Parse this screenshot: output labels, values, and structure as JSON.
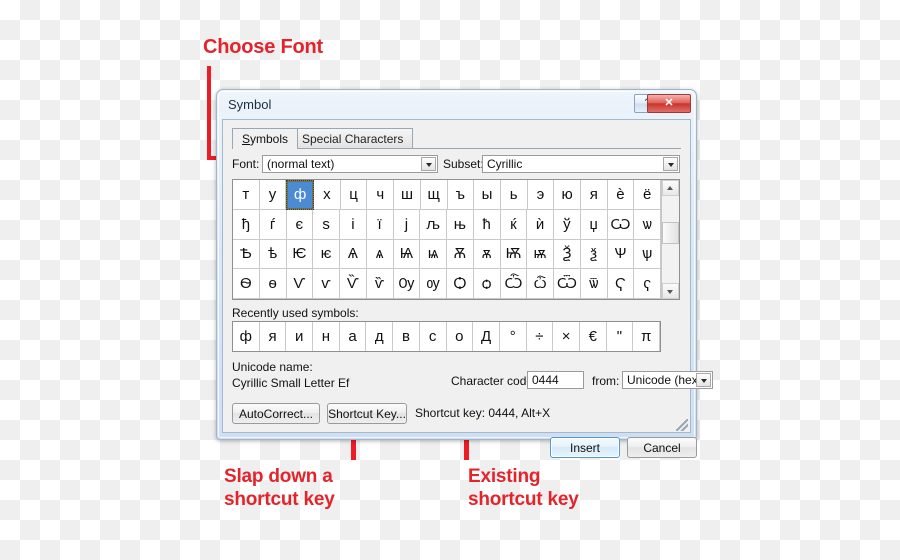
{
  "annotations": [
    {
      "id": "choose-font",
      "text": "Choose Font"
    },
    {
      "id": "slap-shortcut",
      "text": "Slap down a\nshortcut key"
    },
    {
      "id": "existing-shortcut",
      "text": "Existing\nshortcut key"
    }
  ],
  "accent_color": "#ec1c24",
  "dialog": {
    "title": "Symbol",
    "titlebar_buttons": {
      "help": "?",
      "close": "✕"
    },
    "tabs": [
      {
        "label": "Symbols",
        "active": true
      },
      {
        "label": "Special Characters",
        "active": false
      }
    ],
    "font": {
      "label": "Font:",
      "value": "(normal text)"
    },
    "subset": {
      "label": "Subset:",
      "value": "Cyrillic"
    },
    "grid": {
      "selected": "ф",
      "rows": [
        [
          "т",
          "у",
          "ф",
          "х",
          "ц",
          "ч",
          "ш",
          "щ",
          "ъ",
          "ы",
          "ь",
          "э",
          "ю",
          "я",
          "ѐ",
          "ё"
        ],
        [
          "ђ",
          "ѓ",
          "є",
          "ѕ",
          "і",
          "ї",
          "ј",
          "љ",
          "њ",
          "ћ",
          "ќ",
          "ѝ",
          "ў",
          "џ",
          "Ѡ",
          "ѡ"
        ],
        [
          "Ѣ",
          "ѣ",
          "Ѥ",
          "ѥ",
          "Ѧ",
          "ѧ",
          "Ѩ",
          "ѩ",
          "Ѫ",
          "ѫ",
          "Ѭ",
          "ѭ",
          "Ѯ",
          "ѯ",
          "Ѱ",
          "ѱ"
        ],
        [
          "Ѳ",
          "ѳ",
          "Ѵ",
          "ѵ",
          "Ѷ",
          "ѷ",
          "Ѹ",
          "ѹ",
          "Ѻ",
          "ѻ",
          "Ѽ",
          "ѽ",
          "Ѿ",
          "ѿ",
          "Ҁ",
          "ҁ"
        ]
      ]
    },
    "recent": {
      "label": "Recently used symbols:",
      "symbols": [
        "ф",
        "я",
        "и",
        "н",
        "а",
        "д",
        "в",
        "с",
        "о",
        "Д",
        "°",
        "÷",
        "×",
        "€",
        "\"",
        "π"
      ]
    },
    "unicode": {
      "label": "Unicode name:",
      "name": "Cyrillic Small Letter Ef",
      "charcode_label": "Character code:",
      "charcode_value": "0444",
      "from_label": "from:",
      "from_value": "Unicode (hex)"
    },
    "buttons": {
      "autocorrect": "AutoCorrect...",
      "shortcut_key": "Shortcut Key...",
      "shortcut_info": "Shortcut key: 0444, Alt+X",
      "insert": "Insert",
      "cancel": "Cancel"
    },
    "scrollbar": {
      "up": "▲",
      "down": "▼"
    }
  }
}
